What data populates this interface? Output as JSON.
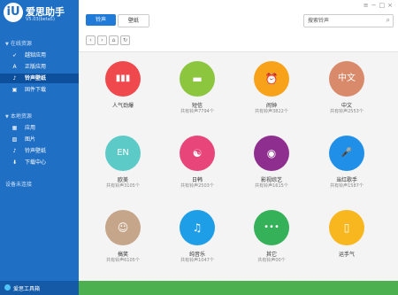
{
  "app": {
    "name": "爱思助手",
    "version": "V5.03(beta5)",
    "logo_text": "iU"
  },
  "sidebar": {
    "online_section": "在线资源",
    "online_items": [
      {
        "label": "越狱应用",
        "icon": "rocket-icon",
        "active": false
      },
      {
        "label": "正版应用",
        "icon": "appstore-icon",
        "active": false
      },
      {
        "label": "铃声壁纸",
        "icon": "music-icon",
        "active": true
      },
      {
        "label": "固件下载",
        "icon": "firmware-icon",
        "active": false
      }
    ],
    "local_section": "本地资源",
    "local_items": [
      {
        "label": "应用",
        "icon": "app-icon"
      },
      {
        "label": "图片",
        "icon": "image-icon"
      },
      {
        "label": "铃声壁纸",
        "icon": "music-icon"
      },
      {
        "label": "下载中心",
        "icon": "download-icon"
      }
    ],
    "device_status": "设备未连接",
    "toolbox": "爱思工具箱"
  },
  "toolbar": {
    "tabs": [
      "铃声",
      "壁纸"
    ],
    "active_tab": "铃声",
    "search_placeholder": "搜索铃声"
  },
  "categories": [
    {
      "name": "人气劲爆",
      "count": "",
      "color": "#f0494d",
      "glyph": "▮▮▮",
      "icon": "bars-icon"
    },
    {
      "name": "短信",
      "count": "共有铃声7794个",
      "color": "#8cc63f",
      "glyph": "▬",
      "icon": "message-icon"
    },
    {
      "name": "闹钟",
      "count": "共有铃声3822个",
      "color": "#f8a21a",
      "glyph": "⏰",
      "icon": "alarm-icon"
    },
    {
      "name": "中文",
      "count": "共有铃声2553个",
      "color": "#d98a6a",
      "glyph": "中文",
      "icon": "chinese-text-icon"
    },
    {
      "name": "欧美",
      "count": "共有铃声3105个",
      "color": "#5ccbc8",
      "glyph": "EN",
      "icon": "english-text-icon"
    },
    {
      "name": "日韩",
      "count": "共有铃声2503个",
      "color": "#e8457a",
      "glyph": "☯",
      "icon": "yin-yang-icon"
    },
    {
      "name": "影视综艺",
      "count": "共有铃声1615个",
      "color": "#8e2e8f",
      "glyph": "◉",
      "icon": "film-reel-icon"
    },
    {
      "name": "当红歌手",
      "count": "共有铃声1587个",
      "color": "#1f8fe8",
      "glyph": "🎤",
      "icon": "microphone-icon"
    },
    {
      "name": "搞笑",
      "count": "共有铃声6105个",
      "color": "#c5a68a",
      "glyph": "☺",
      "icon": "smiley-icon"
    },
    {
      "name": "纯音乐",
      "count": "共有铃声1047个",
      "color": "#1f9ee8",
      "glyph": "♫",
      "icon": "music-note-icon"
    },
    {
      "name": "其它",
      "count": "共有铃声00个",
      "color": "#35b15a",
      "glyph": "•••",
      "icon": "more-icon"
    },
    {
      "name": "运手气",
      "count": "",
      "color": "#f8b71e",
      "glyph": "▯",
      "icon": "shake-phone-icon"
    }
  ]
}
